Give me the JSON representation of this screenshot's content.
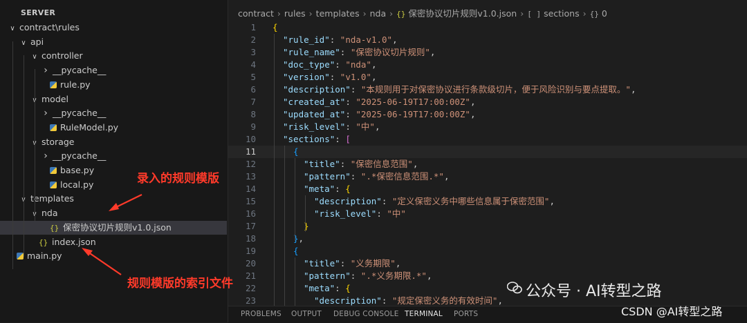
{
  "sidebar": {
    "header": "SERVER",
    "tree": [
      {
        "label": "contract\\rules",
        "type": "folder-open",
        "depth": 0
      },
      {
        "label": "api",
        "type": "folder-open",
        "depth": 1
      },
      {
        "label": "controller",
        "type": "folder-open",
        "depth": 2
      },
      {
        "label": "__pycache__",
        "type": "folder-closed",
        "depth": 3
      },
      {
        "label": "rule.py",
        "type": "python-file",
        "depth": 3
      },
      {
        "label": "model",
        "type": "folder-open",
        "depth": 2
      },
      {
        "label": "__pycache__",
        "type": "folder-closed",
        "depth": 3
      },
      {
        "label": "RuleModel.py",
        "type": "python-file",
        "depth": 3
      },
      {
        "label": "storage",
        "type": "folder-open",
        "depth": 2
      },
      {
        "label": "__pycache__",
        "type": "folder-closed",
        "depth": 3
      },
      {
        "label": "base.py",
        "type": "python-file",
        "depth": 3
      },
      {
        "label": "local.py",
        "type": "python-file",
        "depth": 3
      },
      {
        "label": "templates",
        "type": "folder-open",
        "depth": 1
      },
      {
        "label": "nda",
        "type": "folder-open",
        "depth": 2
      },
      {
        "label": "保密协议切片规则v1.0.json",
        "type": "json-file",
        "depth": 3,
        "selected": true
      },
      {
        "label": "index.json",
        "type": "json-file",
        "depth": 2
      },
      {
        "label": "main.py",
        "type": "python-file",
        "depth": 0
      }
    ]
  },
  "annotations": {
    "template": "录入的规则模版",
    "index": "规则模版的索引文件"
  },
  "breadcrumb": {
    "items": [
      "contract",
      "rules",
      "templates",
      "nda"
    ],
    "json_icon": "{}",
    "file": "保密协议切片规则v1.0.json",
    "array_icon": "[ ]",
    "sections": "sections",
    "obj_icon": "{}",
    "index": "0"
  },
  "editor": {
    "current_line": 11,
    "lines": [
      {
        "n": "1",
        "indent": 0,
        "tokens": [
          [
            "b1",
            "{"
          ]
        ]
      },
      {
        "n": "2",
        "indent": 1,
        "tokens": [
          [
            "k",
            "\"rule_id\""
          ],
          [
            "p",
            ": "
          ],
          [
            "s",
            "\"nda-v1.0\""
          ],
          [
            "p",
            ","
          ]
        ]
      },
      {
        "n": "3",
        "indent": 1,
        "tokens": [
          [
            "k",
            "\"rule_name\""
          ],
          [
            "p",
            ": "
          ],
          [
            "s",
            "\"保密协议切片规则\""
          ],
          [
            "p",
            ","
          ]
        ]
      },
      {
        "n": "4",
        "indent": 1,
        "tokens": [
          [
            "k",
            "\"doc_type\""
          ],
          [
            "p",
            ": "
          ],
          [
            "s",
            "\"nda\""
          ],
          [
            "p",
            ","
          ]
        ]
      },
      {
        "n": "5",
        "indent": 1,
        "tokens": [
          [
            "k",
            "\"version\""
          ],
          [
            "p",
            ": "
          ],
          [
            "s",
            "\"v1.0\""
          ],
          [
            "p",
            ","
          ]
        ]
      },
      {
        "n": "6",
        "indent": 1,
        "tokens": [
          [
            "k",
            "\"description\""
          ],
          [
            "p",
            ": "
          ],
          [
            "s",
            "\"本规则用于对保密协议进行条款级切片，便于风险识别与要点提取。\""
          ],
          [
            "p",
            ","
          ]
        ]
      },
      {
        "n": "7",
        "indent": 1,
        "tokens": [
          [
            "k",
            "\"created_at\""
          ],
          [
            "p",
            ": "
          ],
          [
            "s",
            "\"2025-06-19T17:00:00Z\""
          ],
          [
            "p",
            ","
          ]
        ]
      },
      {
        "n": "8",
        "indent": 1,
        "tokens": [
          [
            "k",
            "\"updated_at\""
          ],
          [
            "p",
            ": "
          ],
          [
            "s",
            "\"2025-06-19T17:00:00Z\""
          ],
          [
            "p",
            ","
          ]
        ]
      },
      {
        "n": "9",
        "indent": 1,
        "tokens": [
          [
            "k",
            "\"risk_level\""
          ],
          [
            "p",
            ": "
          ],
          [
            "s",
            "\"中\""
          ],
          [
            "p",
            ","
          ]
        ]
      },
      {
        "n": "10",
        "indent": 1,
        "tokens": [
          [
            "k",
            "\"sections\""
          ],
          [
            "p",
            ": "
          ],
          [
            "b2",
            "["
          ]
        ]
      },
      {
        "n": "11",
        "indent": 2,
        "tokens": [
          [
            "b3",
            "{"
          ]
        ]
      },
      {
        "n": "12",
        "indent": 3,
        "tokens": [
          [
            "k",
            "\"title\""
          ],
          [
            "p",
            ": "
          ],
          [
            "s",
            "\"保密信息范围\""
          ],
          [
            "p",
            ","
          ]
        ]
      },
      {
        "n": "13",
        "indent": 3,
        "tokens": [
          [
            "k",
            "\"pattern\""
          ],
          [
            "p",
            ": "
          ],
          [
            "s",
            "\".*保密信息范围.*\""
          ],
          [
            "p",
            ","
          ]
        ]
      },
      {
        "n": "14",
        "indent": 3,
        "tokens": [
          [
            "k",
            "\"meta\""
          ],
          [
            "p",
            ": "
          ],
          [
            "b1",
            "{"
          ]
        ]
      },
      {
        "n": "15",
        "indent": 4,
        "tokens": [
          [
            "k",
            "\"description\""
          ],
          [
            "p",
            ": "
          ],
          [
            "s",
            "\"定义保密义务中哪些信息属于保密范围\""
          ],
          [
            "p",
            ","
          ]
        ]
      },
      {
        "n": "16",
        "indent": 4,
        "tokens": [
          [
            "k",
            "\"risk_level\""
          ],
          [
            "p",
            ": "
          ],
          [
            "s",
            "\"中\""
          ]
        ]
      },
      {
        "n": "17",
        "indent": 3,
        "tokens": [
          [
            "b1",
            "}"
          ]
        ]
      },
      {
        "n": "18",
        "indent": 2,
        "tokens": [
          [
            "b3",
            "}"
          ],
          [
            "p",
            ","
          ]
        ]
      },
      {
        "n": "19",
        "indent": 2,
        "tokens": [
          [
            "b3",
            "{"
          ]
        ]
      },
      {
        "n": "20",
        "indent": 3,
        "tokens": [
          [
            "k",
            "\"title\""
          ],
          [
            "p",
            ": "
          ],
          [
            "s",
            "\"义务期限\""
          ],
          [
            "p",
            ","
          ]
        ]
      },
      {
        "n": "21",
        "indent": 3,
        "tokens": [
          [
            "k",
            "\"pattern\""
          ],
          [
            "p",
            ": "
          ],
          [
            "s",
            "\".*义务期限.*\""
          ],
          [
            "p",
            ","
          ]
        ]
      },
      {
        "n": "22",
        "indent": 3,
        "tokens": [
          [
            "k",
            "\"meta\""
          ],
          [
            "p",
            ": "
          ],
          [
            "b1",
            "{"
          ]
        ]
      },
      {
        "n": "23",
        "indent": 4,
        "tokens": [
          [
            "k",
            "\"description\""
          ],
          [
            "p",
            ": "
          ],
          [
            "s",
            "\"规定保密义务的有效时间\""
          ],
          [
            "p",
            ","
          ]
        ]
      }
    ]
  },
  "panel": {
    "tabs": [
      "PROBLEMS",
      "OUTPUT",
      "DEBUG CONSOLE",
      "TERMINAL",
      "PORTS"
    ],
    "active": "TERMINAL"
  },
  "watermark": {
    "wechat": "公众号 · AI转型之路",
    "csdn": "CSDN @AI转型之路"
  },
  "colors": {
    "key": "#9cdcfe",
    "string": "#ce9178",
    "annotation": "#ff3a2a",
    "background": "#1e1e1e",
    "sidebar": "#181818"
  }
}
